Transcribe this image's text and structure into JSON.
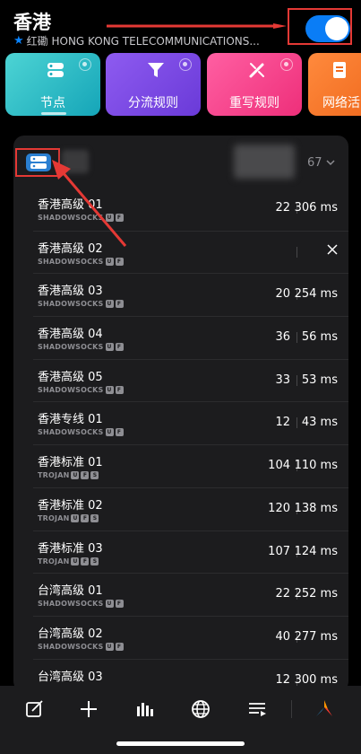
{
  "header": {
    "title": "香港",
    "subtitle": "红磡 HONG KONG TELECOMMUNICATIONS...",
    "toggle_on": true
  },
  "tiles": [
    {
      "label": "节点",
      "icon": "server-icon"
    },
    {
      "label": "分流规则",
      "icon": "filter-icon"
    },
    {
      "label": "重写规则",
      "icon": "pencil-icon"
    },
    {
      "label": "网络活",
      "icon": "document-icon"
    }
  ],
  "group": {
    "count": "67"
  },
  "nodes": [
    {
      "name": "香港高级 01",
      "protocol": "SHADOWSOCKS",
      "badges": [
        "U",
        "F"
      ],
      "num": "22",
      "ms": "306 ms"
    },
    {
      "name": "香港高级 02",
      "protocol": "SHADOWSOCKS",
      "badges": [
        "U",
        "F"
      ],
      "num": "",
      "ms": "",
      "failed": true
    },
    {
      "name": "香港高级 03",
      "protocol": "SHADOWSOCKS",
      "badges": [
        "U",
        "F"
      ],
      "num": "20",
      "ms": "254 ms"
    },
    {
      "name": "香港高级 04",
      "protocol": "SHADOWSOCKS",
      "badges": [
        "U",
        "F"
      ],
      "num": "36",
      "ms": "56 ms"
    },
    {
      "name": "香港高级 05",
      "protocol": "SHADOWSOCKS",
      "badges": [
        "U",
        "F"
      ],
      "num": "33",
      "ms": "53 ms"
    },
    {
      "name": "香港专线 01",
      "protocol": "SHADOWSOCKS",
      "badges": [
        "U",
        "F"
      ],
      "num": "12",
      "ms": "43 ms"
    },
    {
      "name": "香港标准 01",
      "protocol": "TROJAN",
      "badges": [
        "U",
        "F",
        "S"
      ],
      "num": "104",
      "ms": "110 ms"
    },
    {
      "name": "香港标准 02",
      "protocol": "TROJAN",
      "badges": [
        "U",
        "F",
        "S"
      ],
      "num": "120",
      "ms": "138 ms"
    },
    {
      "name": "香港标准 03",
      "protocol": "TROJAN",
      "badges": [
        "U",
        "F",
        "S"
      ],
      "num": "107",
      "ms": "124 ms"
    },
    {
      "name": "台湾高级 01",
      "protocol": "SHADOWSOCKS",
      "badges": [
        "U",
        "F"
      ],
      "num": "22",
      "ms": "252 ms"
    },
    {
      "name": "台湾高级 02",
      "protocol": "SHADOWSOCKS",
      "badges": [
        "U",
        "F"
      ],
      "num": "40",
      "ms": "277 ms"
    },
    {
      "name": "台湾高级 03",
      "protocol": "SHADOWSOCKS",
      "badges": [
        "U",
        "F"
      ],
      "num": "12",
      "ms": "300 ms"
    }
  ],
  "bottom_bar": [
    {
      "icon": "edit-icon"
    },
    {
      "icon": "plus-icon"
    },
    {
      "icon": "stats-icon"
    },
    {
      "icon": "globe-icon"
    },
    {
      "icon": "list-icon"
    },
    {
      "icon": "app-logo-icon"
    }
  ],
  "colors": {
    "accent": "#0a84ff",
    "highlight": "#e53935"
  }
}
